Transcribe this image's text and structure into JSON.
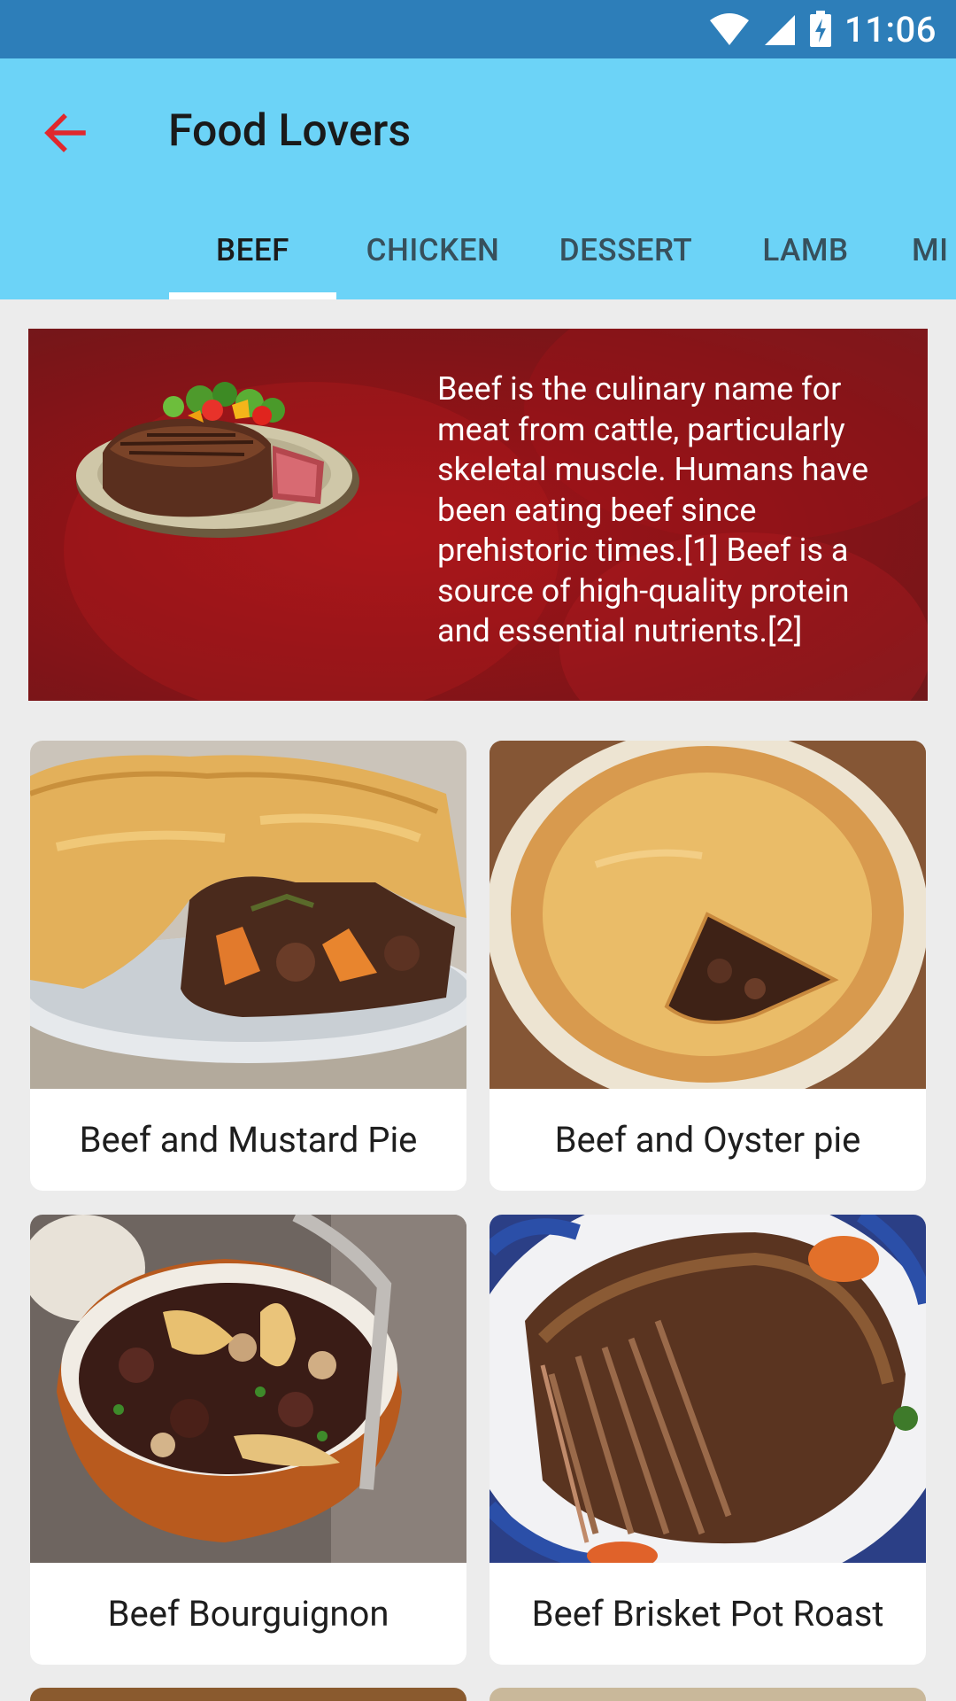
{
  "status_bar": {
    "time": "11:06",
    "icons": [
      "wifi-icon",
      "signal-icon",
      "battery-charging-icon"
    ]
  },
  "app_bar": {
    "title": "Food Lovers",
    "back_icon": "arrow-left-icon",
    "colors": {
      "background": "#6CD3F7",
      "status_bar": "#2D7EB9",
      "back_arrow": "#E0282D"
    }
  },
  "tabs": [
    {
      "label": "BEEF",
      "active": true
    },
    {
      "label": "CHICKEN",
      "active": false
    },
    {
      "label": "DESSERT",
      "active": false
    },
    {
      "label": "LAMB",
      "active": false
    },
    {
      "label": "MI",
      "active": false
    }
  ],
  "category_banner": {
    "description": "Beef is the culinary name for meat from cattle, particularly skeletal muscle. Humans have been eating beef since prehistoric times.[1] Beef is a source of high-quality protein and essential nutrients.[2]"
  },
  "meals": [
    {
      "name": "Beef and Mustard Pie"
    },
    {
      "name": "Beef and Oyster pie"
    },
    {
      "name": "Beef Bourguignon"
    },
    {
      "name": "Beef Brisket Pot Roast"
    }
  ]
}
